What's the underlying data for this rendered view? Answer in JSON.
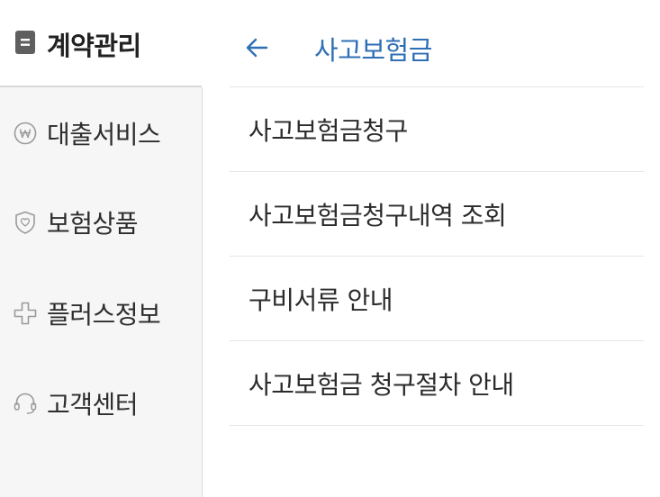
{
  "sidebar": {
    "header": {
      "icon": "document-icon",
      "title": "계약관리"
    },
    "items": [
      {
        "icon": "won-coin-icon",
        "label": "대출서비스"
      },
      {
        "icon": "shield-heart-icon",
        "label": "보험상품"
      },
      {
        "icon": "plus-outline-icon",
        "label": "플러스정보"
      },
      {
        "icon": "headset-icon",
        "label": "고객센터"
      }
    ]
  },
  "main": {
    "back_icon": "arrow-left-icon",
    "title": "사고보험금",
    "items": [
      {
        "label": "사고보험금청구"
      },
      {
        "label": "사고보험금청구내역 조회"
      },
      {
        "label": "구비서류 안내"
      },
      {
        "label": "사고보험금 청구절차 안내"
      }
    ]
  },
  "colors": {
    "accent": "#2f6fb4",
    "sidebar_bg": "#f6f6f6",
    "divider": "#e6e6e6",
    "icon_gray": "#9a9a9a"
  }
}
